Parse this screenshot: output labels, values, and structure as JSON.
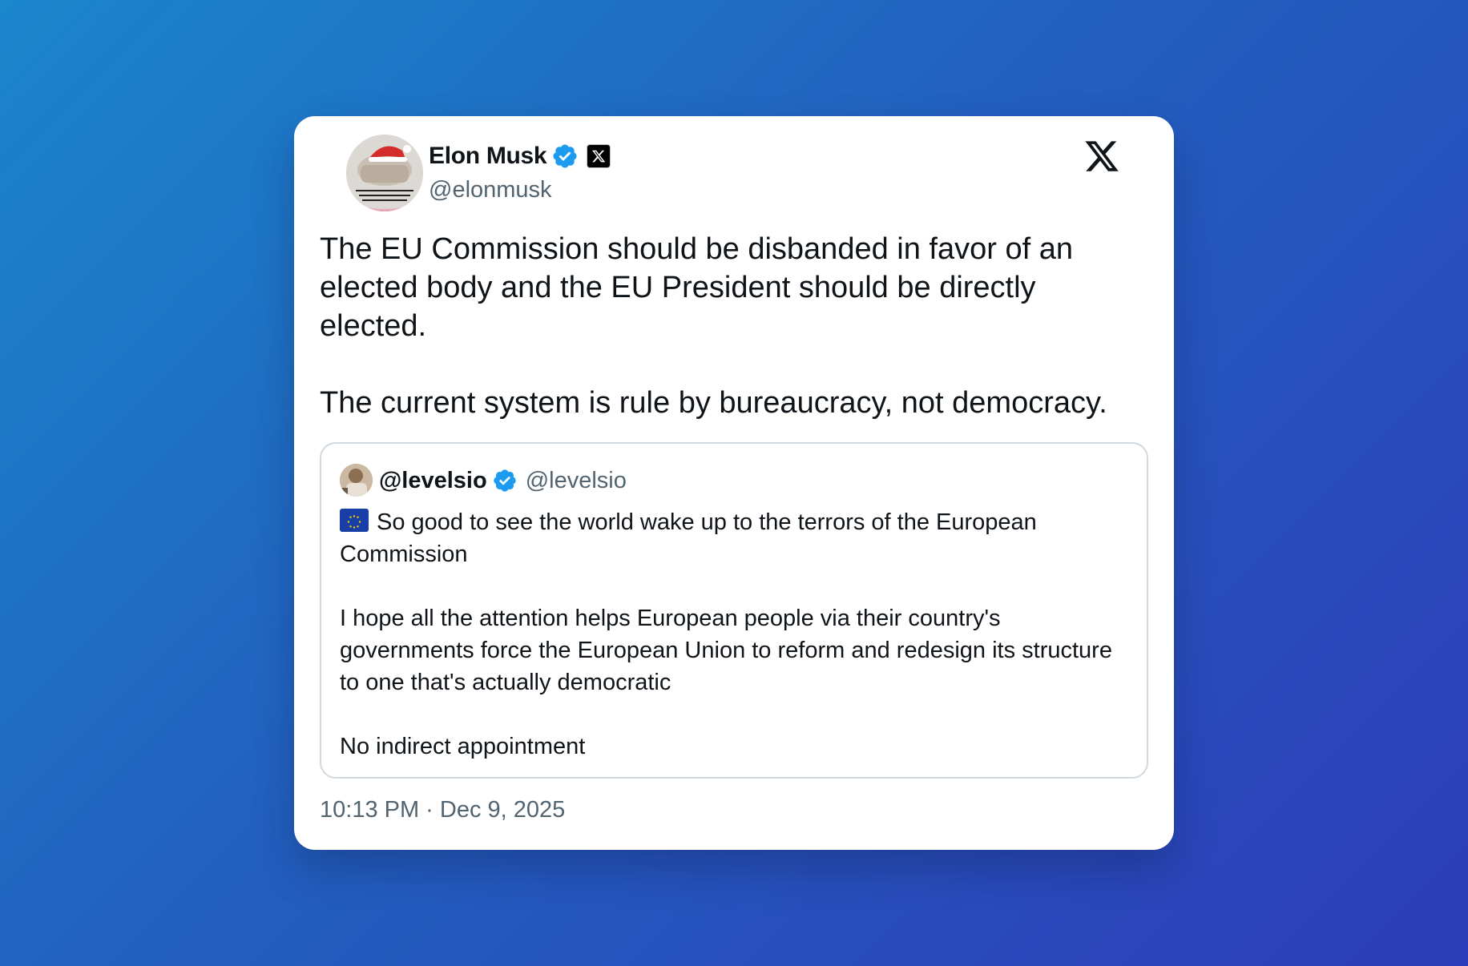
{
  "author": {
    "name": "Elon Musk",
    "handle": "@elonmusk"
  },
  "tweet": {
    "paragraphs": [
      "The EU Commission should be disbanded in favor of an elected body and the EU President should be directly elected.",
      "The current system is rule by bureaucracy, not democracy."
    ],
    "timestamp": "10:13 PM · Dec 9, 2025"
  },
  "quoted": {
    "name": "@levelsio",
    "handle": "@levelsio",
    "flag_icon": "eu-flag-icon",
    "paragraphs": [
      "So good to see the world wake up to the terrors of the European Commission",
      "I hope all the attention helps European people via their country's governments force the European Union to reform and redesign its structure to one that's actually democratic",
      "No indirect appointment"
    ]
  },
  "colors": {
    "verified": "#1d9bf0",
    "text": "#0f1419",
    "muted": "#536471",
    "border": "#cfd9de",
    "background_start": "#1a86cc",
    "background_end": "#2d3cb8"
  },
  "icons": [
    "verified-badge-icon",
    "x-affiliate-badge-icon",
    "x-logo-icon",
    "eu-flag-icon"
  ]
}
